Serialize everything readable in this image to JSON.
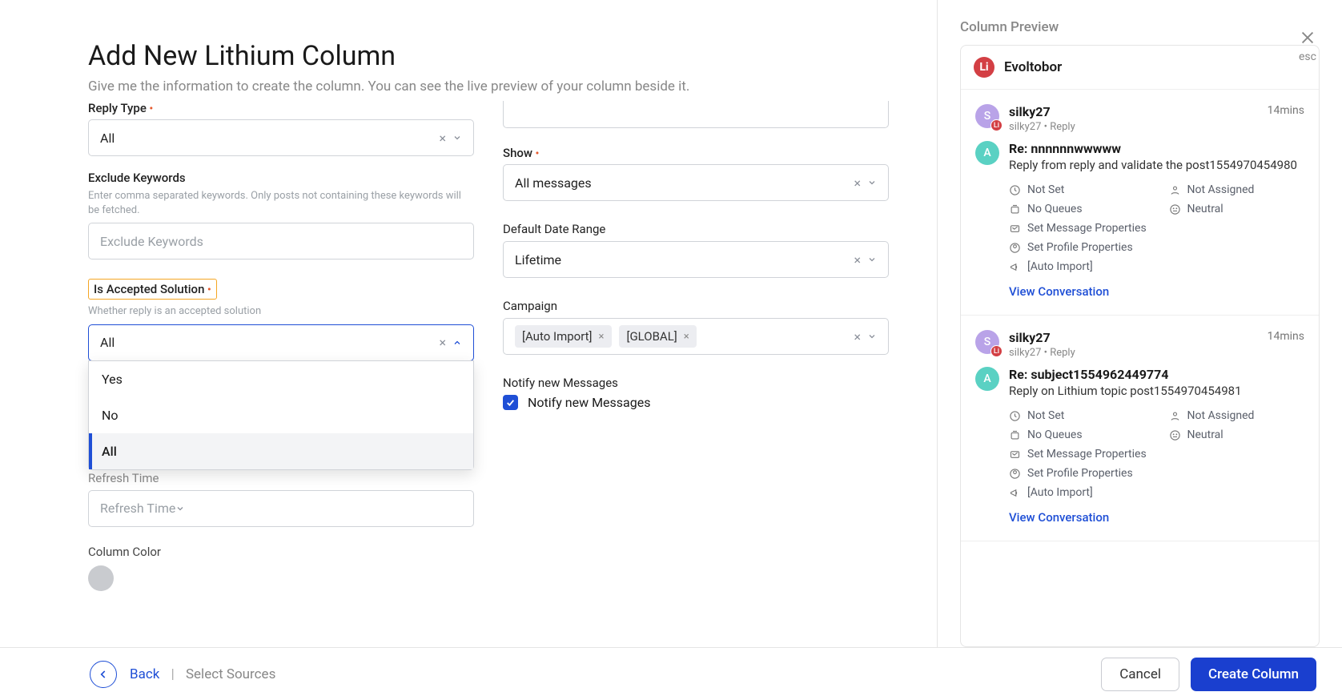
{
  "header": {
    "title": "Add New Lithium Column",
    "subtitle": "Give me the information to create the column. You can see the live preview of your column beside it."
  },
  "close": {
    "label": "esc"
  },
  "form": {
    "replyType": {
      "label": "Reply Type",
      "value": "All"
    },
    "excludeKeywords": {
      "label": "Exclude Keywords",
      "help": "Enter comma separated keywords. Only posts not containing these keywords will be fetched.",
      "placeholder": "Exclude Keywords"
    },
    "acceptedSolution": {
      "label": "Is Accepted Solution",
      "help": "Whether reply is an accepted solution",
      "value": "All",
      "options": [
        "Yes",
        "No",
        "All"
      ]
    },
    "refreshTime": {
      "label": "Refresh Time",
      "placeholder": "Refresh Time"
    },
    "columnColor": {
      "label": "Column Color"
    },
    "show": {
      "label": "Show",
      "value": "All messages"
    },
    "defaultDateRange": {
      "label": "Default Date Range",
      "value": "Lifetime"
    },
    "campaign": {
      "label": "Campaign",
      "tags": [
        "[Auto Import]",
        "[GLOBAL]"
      ]
    },
    "notify": {
      "label": "Notify new Messages",
      "checkboxLabel": "Notify new Messages",
      "checked": true
    }
  },
  "footer": {
    "back": "Back",
    "crumbPast": "Select Sources",
    "cancel": "Cancel",
    "create": "Create Column"
  },
  "preview": {
    "title": "Column Preview",
    "source": "Evoltobor",
    "messages": [
      {
        "author": "silky27",
        "authorMeta": "silky27 • Reply",
        "time": "14mins",
        "avatar1": "S",
        "avatar2": "A",
        "subject": "Re: nnnnnnwwwww",
        "body": "Reply from reply and validate the post1554970454980",
        "meta": {
          "sla": "Not Set",
          "assigned": "Not Assigned",
          "queue": "No Queues",
          "sentiment": "Neutral",
          "msgProps": "Set Message Properties",
          "profileProps": "Set Profile Properties",
          "campaign": "[Auto Import]"
        },
        "viewLink": "View Conversation"
      },
      {
        "author": "silky27",
        "authorMeta": "silky27 • Reply",
        "time": "14mins",
        "avatar1": "S",
        "avatar2": "A",
        "subject": "Re: subject1554962449774",
        "body": "Reply on Lithium topic post1554970454981",
        "meta": {
          "sla": "Not Set",
          "assigned": "Not Assigned",
          "queue": "No Queues",
          "sentiment": "Neutral",
          "msgProps": "Set Message Properties",
          "profileProps": "Set Profile Properties",
          "campaign": "[Auto Import]"
        },
        "viewLink": "View Conversation"
      }
    ]
  }
}
